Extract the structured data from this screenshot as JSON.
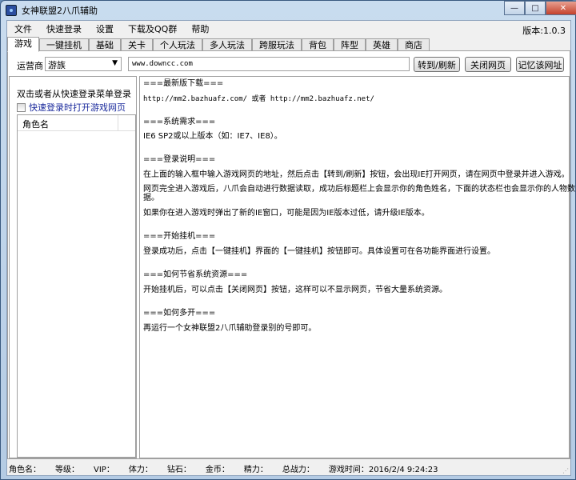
{
  "window": {
    "title": "女神联盟2八爪辅助",
    "version": "版本:1.0.3"
  },
  "menu": [
    "文件",
    "快速登录",
    "设置",
    "下载及QQ群",
    "帮助"
  ],
  "tabs": [
    "游戏",
    "一键挂机",
    "基础",
    "关卡",
    "个人玩法",
    "多人玩法",
    "跨服玩法",
    "背包",
    "阵型",
    "英雄",
    "商店"
  ],
  "address": {
    "operator_label": "运营商",
    "operator_value": "游族",
    "url": "www.downcc.com",
    "go_button": "转到/刷新",
    "close_button": "关闭网页",
    "remember_button": "记忆该网址"
  },
  "left": {
    "hint": "双击或者从快速登录菜单登录",
    "checkbox_label": "快速登录时打开游戏网页",
    "checkbox_checked": false,
    "column_header": "角色名"
  },
  "content": [
    "===最新版下载===",
    "http://mm2.bazhuafz.com/ 或者 http://mm2.bazhuafz.net/",
    "===系统需求===",
    "IE6 SP2或以上版本（如：IE7、IE8）。",
    "===登录说明===",
    "在上面的输入框中输入游戏网页的地址，然后点击【转到/刷新】按钮，会出现IE打开网页，请在网页中登录并进入游戏。",
    "网页完全进入游戏后，八爪会自动进行数据读取，成功后标题栏上会显示你的角色姓名，下面的状态栏也会显示你的人物数",
    "据。",
    "如果你在进入游戏时弹出了新的IE窗口，可能是因为IE版本过低，请升级IE版本。",
    "===开始挂机===",
    "登录成功后，点击【一键挂机】界面的【一键挂机】按钮即可。具体设置可在各功能界面进行设置。",
    "===如何节省系统资源===",
    "开始挂机后，可以点击【关闭网页】按钮，这样可以不显示网页，节省大量系统资源。",
    "===如何多开===",
    "再运行一个女神联盟2八爪辅助登录别的号即可。"
  ],
  "status": [
    "角色名：",
    "等级：",
    "VIP：",
    "体力：",
    "钻石：",
    "金币：",
    "精力：",
    "总战力：",
    "游戏时间：2016/2/4 9:24:23"
  ]
}
